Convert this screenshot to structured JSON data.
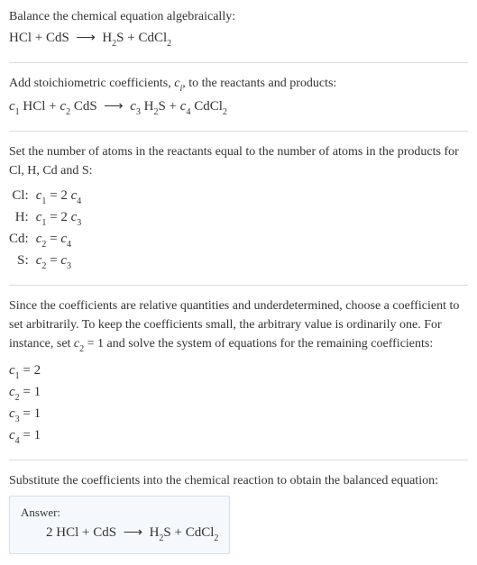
{
  "sections": {
    "s1": {
      "text": "Balance the chemical equation algebraically:",
      "eq_left1": "HCl + CdS",
      "arrow": "⟶",
      "eq_right1a": "H",
      "eq_right1a_sub": "2",
      "eq_right1b": "S + CdCl",
      "eq_right1b_sub": "2"
    },
    "s2": {
      "text_a": "Add stoichiometric coefficients, ",
      "ci": "c",
      "ci_sub": "i",
      "text_b": ", to the reactants and products:",
      "c1": "c",
      "n1": "1",
      "p1": " HCl + ",
      "c2": "c",
      "n2": "2",
      "p2": " CdS",
      "arrow": "⟶",
      "c3": "c",
      "n3": "3",
      "p3": " H",
      "h2": "2",
      "p4": "S + ",
      "c4": "c",
      "n4": "4",
      "p5": " CdCl",
      "cl2": "2"
    },
    "s3": {
      "text": "Set the number of atoms in the reactants equal to the number of atoms in the products for Cl, H, Cd and S:",
      "rows": [
        {
          "el": "Cl:",
          "c_l": "c",
          "n_l": "1",
          "eq": " = 2 ",
          "c_r": "c",
          "n_r": "4",
          "tail": ""
        },
        {
          "el": "H:",
          "c_l": "c",
          "n_l": "1",
          "eq": " = 2 ",
          "c_r": "c",
          "n_r": "3",
          "tail": ""
        },
        {
          "el": "Cd:",
          "c_l": "c",
          "n_l": "2",
          "eq": " = ",
          "c_r": "c",
          "n_r": "4",
          "tail": ""
        },
        {
          "el": "S:",
          "c_l": "c",
          "n_l": "2",
          "eq": " = ",
          "c_r": "c",
          "n_r": "3",
          "tail": ""
        }
      ]
    },
    "s4": {
      "text_a": "Since the coefficients are relative quantities and underdetermined, choose a coefficient to set arbitrarily. To keep the coefficients small, the arbitrary value is ordinarily one. For instance, set ",
      "c": "c",
      "n": "2",
      "text_b": " = 1 and solve the system of equations for the remaining coefficients:",
      "coefs": [
        {
          "c": "c",
          "n": "1",
          "val": " = 2"
        },
        {
          "c": "c",
          "n": "2",
          "val": " = 1"
        },
        {
          "c": "c",
          "n": "3",
          "val": " = 1"
        },
        {
          "c": "c",
          "n": "4",
          "val": " = 1"
        }
      ]
    },
    "s5": {
      "text": "Substitute the coefficients into the chemical reaction to obtain the balanced equation:"
    },
    "answer": {
      "label": "Answer:",
      "eq_a": "2 HCl + CdS",
      "arrow": "⟶",
      "eq_b": "H",
      "h2": "2",
      "eq_c": "S + CdCl",
      "cl2": "2"
    }
  },
  "chart_data": {
    "type": "table",
    "title": "Balancing HCl + CdS → H2S + CdCl2",
    "reaction_unbalanced": "HCl + CdS -> H2S + CdCl2",
    "atom_equations": [
      {
        "element": "Cl",
        "equation": "c1 = 2*c4"
      },
      {
        "element": "H",
        "equation": "c1 = 2*c3"
      },
      {
        "element": "Cd",
        "equation": "c2 = c4"
      },
      {
        "element": "S",
        "equation": "c2 = c3"
      }
    ],
    "solution": {
      "c1": 2,
      "c2": 1,
      "c3": 1,
      "c4": 1
    },
    "reaction_balanced": "2 HCl + CdS -> H2S + CdCl2"
  }
}
